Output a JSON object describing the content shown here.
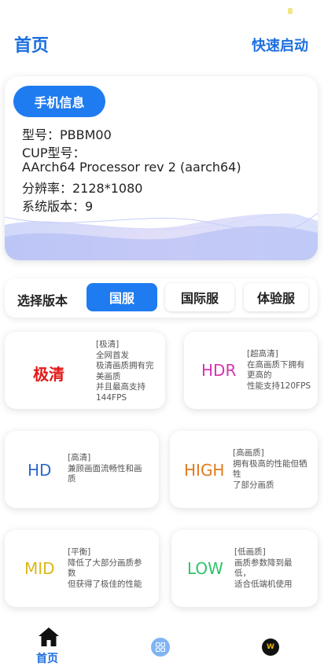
{
  "header": {
    "title": "首页",
    "quick_start": "快速启动"
  },
  "device_info": {
    "badge": "手机信息",
    "model": "型号：PBBM00",
    "cpu_label": "CUP型号：",
    "cpu_value": "AArch64 Processor rev 2 (aarch64)",
    "resolution": "分辨率：2128*1080",
    "system_version": "系统版本：9"
  },
  "version_selector": {
    "label": "选择版本",
    "options": [
      "国服",
      "国际服",
      "体验服"
    ],
    "selected": "国服"
  },
  "modes": [
    {
      "name": "极清",
      "color": "#e31919",
      "desc": [
        "[极清]",
        "全网首发",
        "极清画质拥有完",
        "美画质",
        "并且最高支持",
        "144FPS"
      ]
    },
    {
      "name": "HDR",
      "color": "#d633b4",
      "desc": [
        "[超高清]",
        "在高画质下拥有",
        "更高的",
        "性能支持120FPS"
      ]
    },
    {
      "name": "HD",
      "color": "#2c6ac9",
      "desc": [
        "[高清]",
        "兼顾画面流畅性和画",
        "质"
      ]
    },
    {
      "name": "HIGH",
      "color": "#e07b1c",
      "desc": [
        "[高画质]",
        "拥有极高的性能但牺",
        "牲",
        "了部分画质"
      ]
    },
    {
      "name": "MID",
      "color": "#d9b81a",
      "desc": [
        "[平衡]",
        "降低了大部分画质参",
        "数",
        "但获得了极佳的性能"
      ]
    },
    {
      "name": "LOW",
      "color": "#2ec46a",
      "desc": [
        "[低画质]",
        "画质参数降到最",
        "低，",
        "适合低端机使用"
      ]
    }
  ],
  "bottom_nav": {
    "home_label": "首页",
    "badge_letter": "W"
  }
}
